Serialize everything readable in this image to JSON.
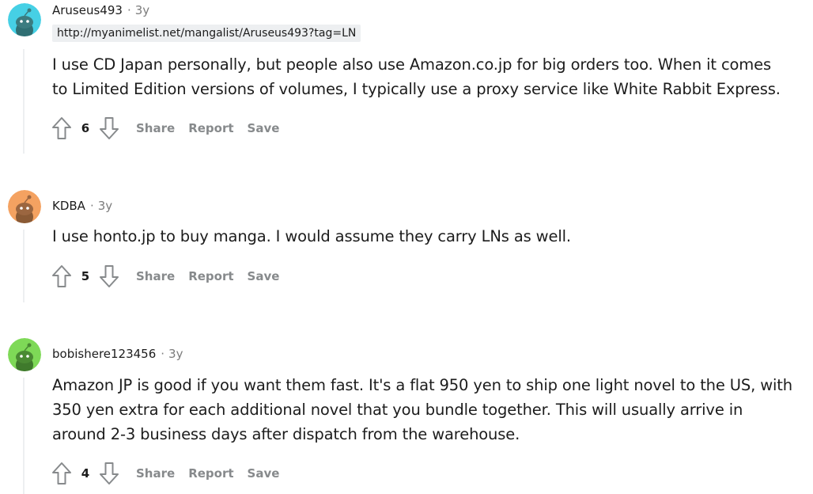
{
  "comments": [
    {
      "username": "Aruseus493",
      "age": "3y",
      "flair": "http://myanimelist.net/mangalist/Aruseus493?tag=LN",
      "avatar_color": "#46d0e5",
      "body_lines": [
        "I use CD Japan personally, but people also use Amazon.co.jp for big orders too. When it comes",
        "to Limited Edition versions of volumes, I typically use a proxy service like White Rabbit Express."
      ],
      "score": "6",
      "actions": {
        "share": "Share",
        "report": "Report",
        "save": "Save"
      }
    },
    {
      "username": "KDBA",
      "age": "3y",
      "avatar_color": "#f4a261",
      "body_lines": [
        "I use honto.jp to buy manga. I would assume they carry LNs as well."
      ],
      "score": "5",
      "actions": {
        "share": "Share",
        "report": "Report",
        "save": "Save"
      }
    },
    {
      "username": "bobishere123456",
      "age": "3y",
      "avatar_color": "#7ed957",
      "body_lines": [
        "Amazon JP is good if you want them fast. It's a flat 950 yen to ship one light novel to the US, with",
        "350 yen extra for each additional novel that you bundle together. This will usually arrive in",
        "around 2-3 business days after dispatch from the warehouse."
      ],
      "score": "4",
      "actions": {
        "share": "Share",
        "report": "Report",
        "save": "Save"
      }
    }
  ],
  "separator": "·",
  "icons": {
    "upvote": "arrow-up-icon",
    "downvote": "arrow-down-icon",
    "avatar": "snoo-avatar-icon"
  }
}
